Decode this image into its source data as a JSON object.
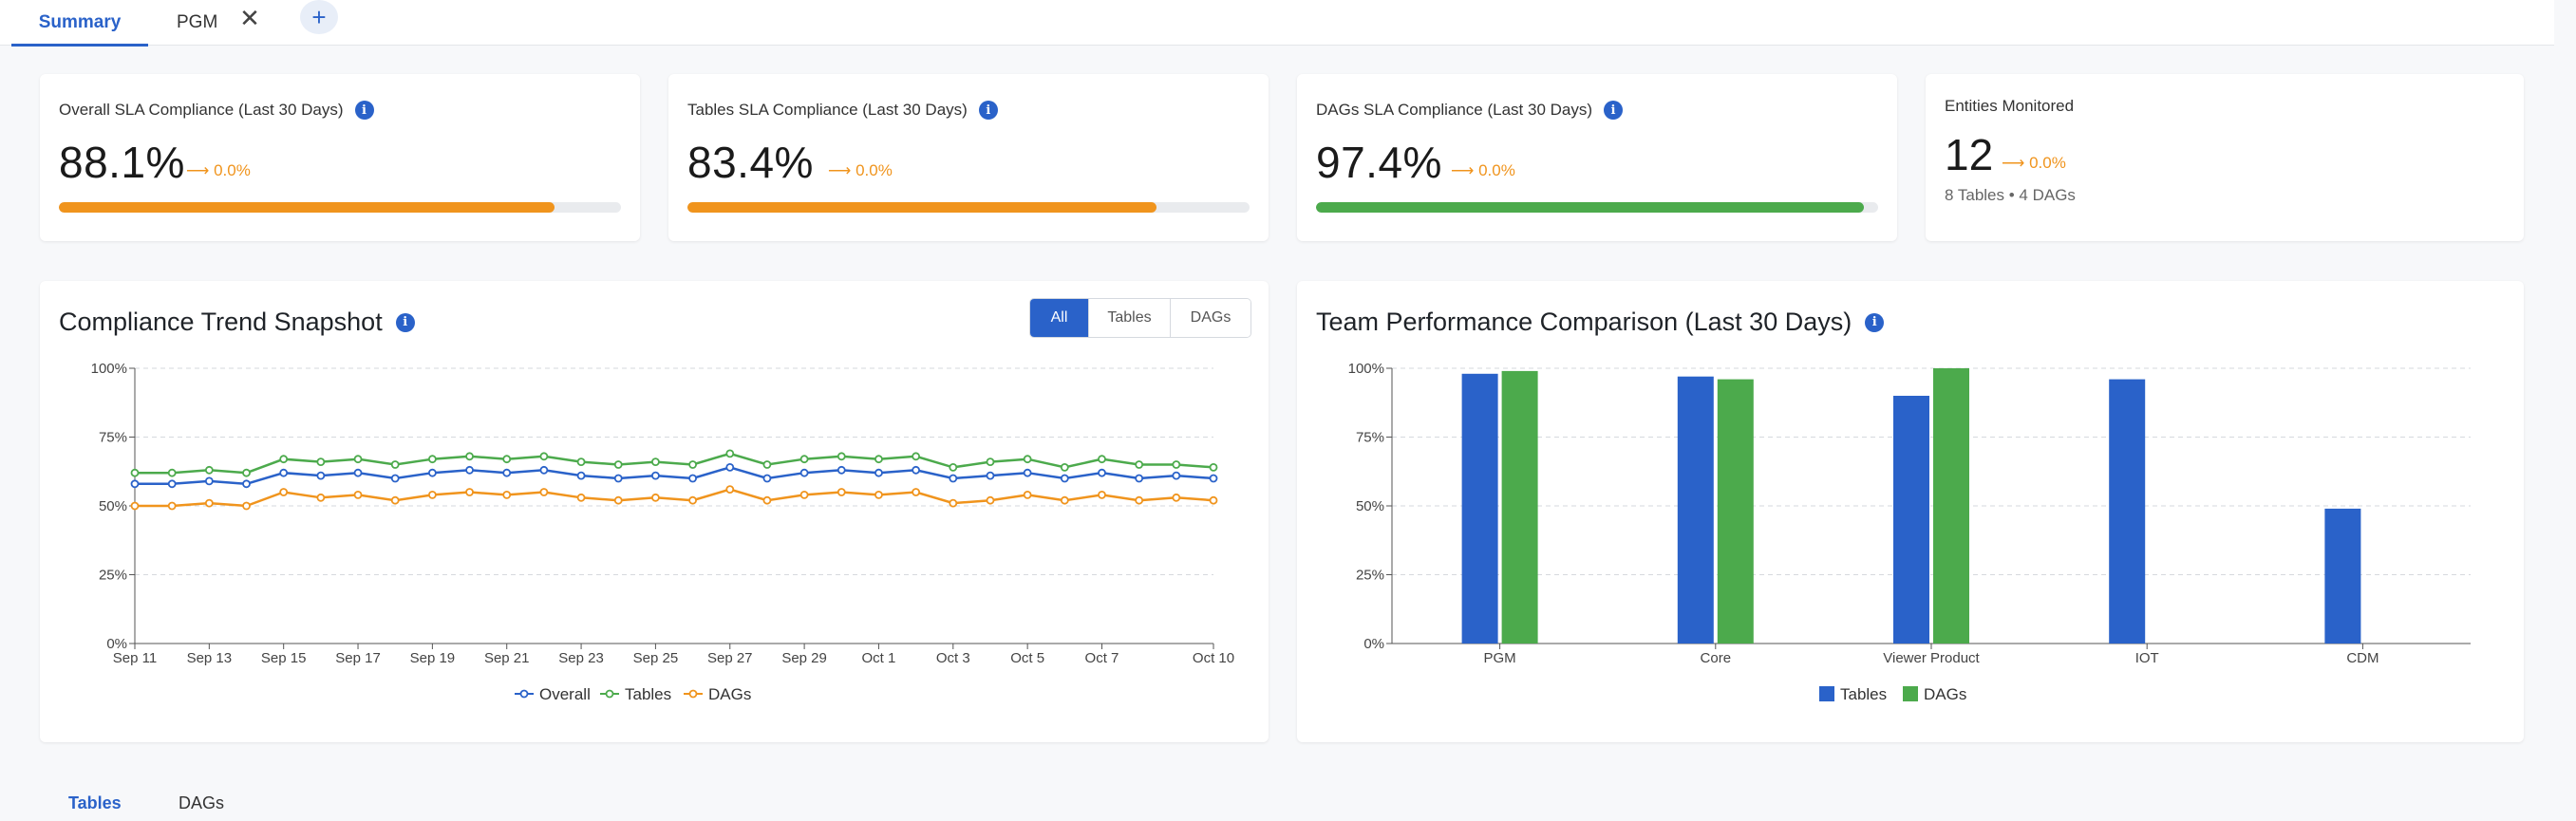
{
  "tabs": {
    "summary": "Summary",
    "pgm": "PGM",
    "close_glyph": "✕",
    "add_glyph": "+"
  },
  "kpis": [
    {
      "label": "Overall SLA Compliance (Last 30 Days)",
      "value": "88.1%",
      "trend": "⟶ 0.0%",
      "progress": 0.881,
      "color": "#f0941d"
    },
    {
      "label": "Tables SLA Compliance (Last 30 Days)",
      "value": "83.4%",
      "trend": "⟶ 0.0%",
      "progress": 0.834,
      "color": "#f0941d"
    },
    {
      "label": "DAGs SLA Compliance (Last 30 Days)",
      "value": "97.4%",
      "trend": "⟶ 0.0%",
      "progress": 0.974,
      "color": "#4caa4c"
    }
  ],
  "entities": {
    "label": "Entities Monitored",
    "value": "12",
    "trend": "⟶ 0.0%",
    "sub": "8 Tables • 4 DAGs"
  },
  "info_glyph": "i",
  "trend_panel": {
    "title": "Compliance Trend Snapshot",
    "filters": [
      "All",
      "Tables",
      "DAGs"
    ],
    "active_filter": "All"
  },
  "team_panel": {
    "title": "Team Performance Comparison (Last 30 Days)"
  },
  "colors": {
    "primary": "#2a62c9",
    "overall": "#2a62c9",
    "tables": "#4caa4c",
    "dags": "#f0941d",
    "bar_tables": "#2a62c9",
    "bar_dags": "#4caa4c"
  },
  "chart_data": [
    {
      "type": "line",
      "title": "Compliance Trend Snapshot",
      "x": [
        "Sep 11",
        "Sep 12",
        "Sep 13",
        "Sep 14",
        "Sep 15",
        "Sep 16",
        "Sep 17",
        "Sep 18",
        "Sep 19",
        "Sep 20",
        "Sep 21",
        "Sep 22",
        "Sep 23",
        "Sep 24",
        "Sep 25",
        "Sep 26",
        "Sep 27",
        "Sep 28",
        "Sep 29",
        "Sep 30",
        "Oct 1",
        "Oct 2",
        "Oct 3",
        "Oct 4",
        "Oct 5",
        "Oct 6",
        "Oct 7",
        "Oct 8",
        "Oct 9",
        "Oct 10"
      ],
      "xticks": [
        "Sep 11",
        "Sep 13",
        "Sep 15",
        "Sep 17",
        "Sep 19",
        "Sep 21",
        "Sep 23",
        "Sep 25",
        "Sep 27",
        "Sep 29",
        "Oct 1",
        "Oct 3",
        "Oct 5",
        "Oct 7",
        "Oct 10"
      ],
      "yticks": [
        "0%",
        "25%",
        "50%",
        "75%",
        "100%"
      ],
      "ylim": [
        0,
        100
      ],
      "grid": true,
      "legend": "bottom-center",
      "series": [
        {
          "name": "Overall",
          "values": [
            58,
            58,
            59,
            58,
            62,
            61,
            62,
            60,
            62,
            63,
            62,
            63,
            61,
            60,
            61,
            60,
            64,
            60,
            62,
            63,
            62,
            63,
            60,
            61,
            62,
            60,
            62,
            60,
            61,
            60
          ]
        },
        {
          "name": "Tables",
          "values": [
            62,
            62,
            63,
            62,
            67,
            66,
            67,
            65,
            67,
            68,
            67,
            68,
            66,
            65,
            66,
            65,
            69,
            65,
            67,
            68,
            67,
            68,
            64,
            66,
            67,
            64,
            67,
            65,
            65,
            64
          ]
        },
        {
          "name": "DAGs",
          "values": [
            50,
            50,
            51,
            50,
            55,
            53,
            54,
            52,
            54,
            55,
            54,
            55,
            53,
            52,
            53,
            52,
            56,
            52,
            54,
            55,
            54,
            55,
            51,
            52,
            54,
            52,
            54,
            52,
            53,
            52
          ]
        }
      ]
    },
    {
      "type": "bar",
      "title": "Team Performance Comparison (Last 30 Days)",
      "categories": [
        "PGM",
        "Core",
        "Viewer Product",
        "IOT",
        "CDM"
      ],
      "yticks": [
        "0%",
        "25%",
        "50%",
        "75%",
        "100%"
      ],
      "ylim": [
        0,
        100
      ],
      "grid": true,
      "legend": "bottom-center",
      "series": [
        {
          "name": "Tables",
          "values": [
            98,
            97,
            90,
            96,
            49
          ]
        },
        {
          "name": "DAGs",
          "values": [
            99,
            96,
            100,
            null,
            null
          ]
        }
      ]
    }
  ],
  "bottom_tabs": [
    "Tables",
    "DAGs"
  ]
}
